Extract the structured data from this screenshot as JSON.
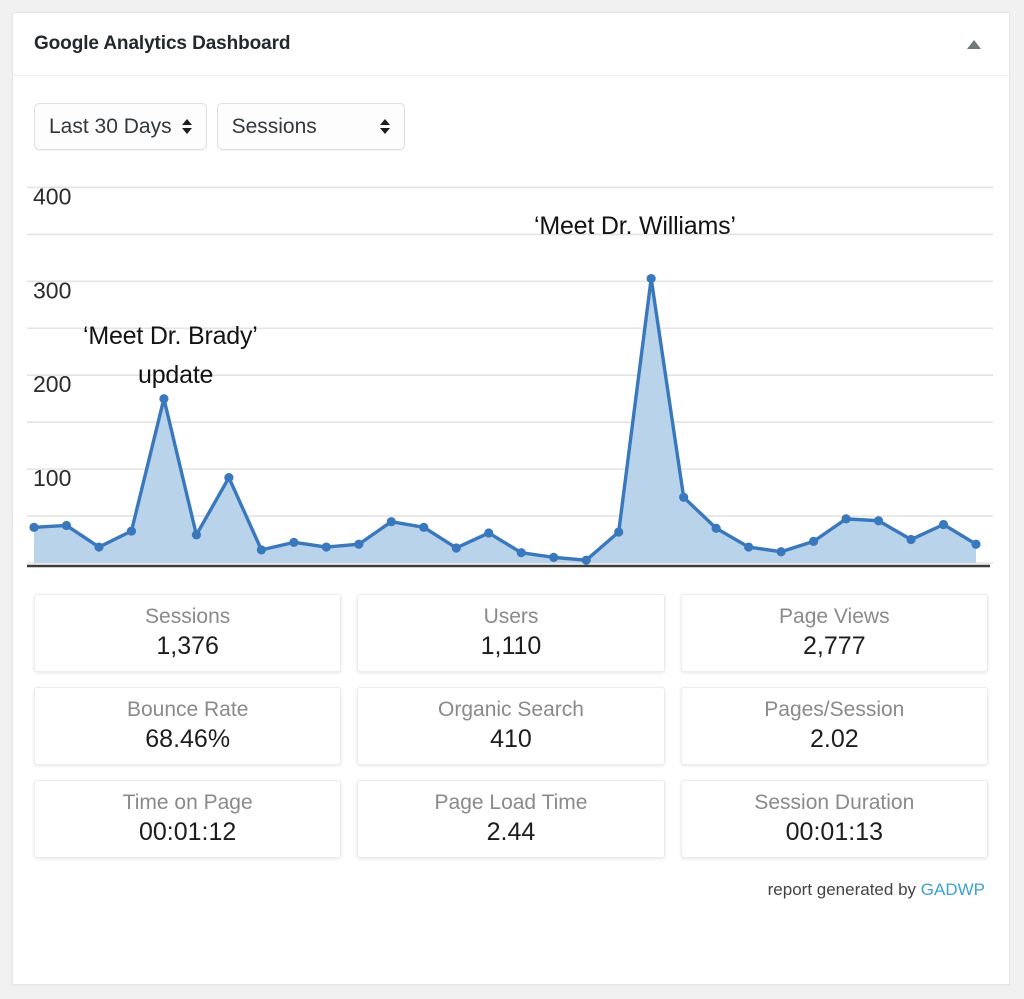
{
  "header": {
    "title": "Google Analytics Dashboard",
    "collapse_icon": "caret-up-icon"
  },
  "controls": {
    "date_range": {
      "selected": "Last 30 Days",
      "options": [
        "Last 30 Days"
      ]
    },
    "metric": {
      "selected": "Sessions",
      "options": [
        "Sessions"
      ]
    }
  },
  "annotations": [
    {
      "line1": "‘Meet Dr. Brady’",
      "line2": "update"
    },
    {
      "line1": "‘Meet Dr. Williams’"
    }
  ],
  "anno": {
    "brady_line1": "‘Meet Dr. Brady’",
    "brady_line2": "update",
    "williams_line1": "‘Meet Dr. Williams’"
  },
  "cards": [
    [
      {
        "label": "Sessions",
        "value": "1,376"
      },
      {
        "label": "Users",
        "value": "1,110"
      },
      {
        "label": "Page Views",
        "value": "2,777"
      }
    ],
    [
      {
        "label": "Bounce Rate",
        "value": "68.46%"
      },
      {
        "label": "Organic Search",
        "value": "410"
      },
      {
        "label": "Pages/Session",
        "value": "2.02"
      }
    ],
    [
      {
        "label": "Time on Page",
        "value": "00:01:12"
      },
      {
        "label": "Page Load Time",
        "value": "2.44"
      },
      {
        "label": "Session Duration",
        "value": "00:01:13"
      }
    ]
  ],
  "footer": {
    "text": "report generated by",
    "link": "GADWP"
  },
  "colors": {
    "line": "#3a78bd",
    "fill": "#b8d3ea",
    "grid": "#e3e3e3",
    "axis": "#3c3c3c",
    "link": "#3ba2d3",
    "label": "#8a8a8a",
    "value": "#1d1d1d"
  },
  "chart_data": {
    "type": "area",
    "title": "",
    "xlabel": "",
    "ylabel": "",
    "ylim": [
      0,
      425
    ],
    "yticks": [
      100,
      200,
      300,
      400
    ],
    "ytick_labels": [
      "100",
      "200",
      "300",
      "400"
    ],
    "gridline_step": 50,
    "grid": true,
    "legend": "none",
    "series_name": "Sessions",
    "x": [
      1,
      2,
      3,
      4,
      5,
      6,
      7,
      8,
      9,
      10,
      11,
      12,
      13,
      14,
      15,
      16,
      17,
      18,
      19,
      20,
      21,
      22,
      23,
      24,
      25,
      26,
      27,
      28,
      29,
      30
    ],
    "values": [
      38,
      40,
      17,
      34,
      175,
      30,
      91,
      14,
      22,
      17,
      20,
      44,
      38,
      16,
      32,
      11,
      6,
      3,
      33,
      303,
      70,
      37,
      17,
      12,
      23,
      47,
      45,
      25,
      41,
      20
    ],
    "annotations": [
      {
        "label": "‘Meet Dr. Brady’ update",
        "x_index": 5,
        "y": 175
      },
      {
        "label": "‘Meet Dr. Williams’",
        "x_index": 20,
        "y": 303
      }
    ]
  }
}
